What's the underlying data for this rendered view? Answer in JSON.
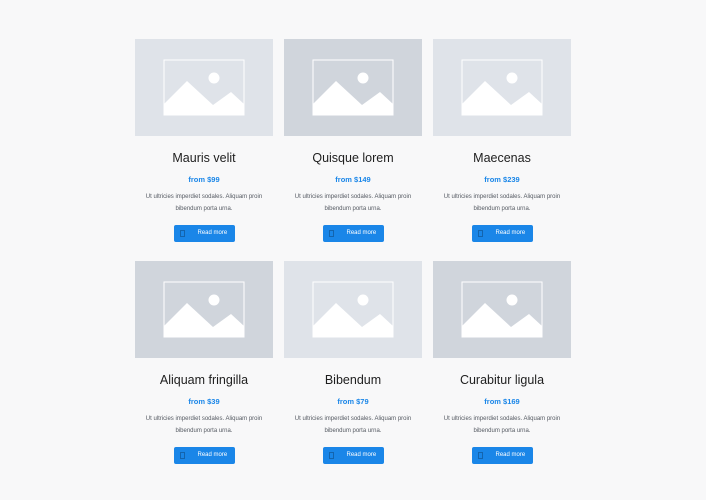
{
  "cards": [
    {
      "title": "Mauris velit",
      "price": "from $99",
      "description": "Ut ultricies imperdiet sodales. Aliquam proin bibendum porta urna.",
      "button_label": "Read more",
      "image_icon": "image-placeholder-icon",
      "tone": "light"
    },
    {
      "title": "Quisque lorem",
      "price": "from $149",
      "description": "Ut ultricies imperdiet sodales. Aliquam proin bibendum porta urna.",
      "button_label": "Read more",
      "image_icon": "image-placeholder-icon",
      "tone": "dark"
    },
    {
      "title": "Maecenas",
      "price": "from $239",
      "description": "Ut ultricies imperdiet sodales. Aliquam proin bibendum porta urna.",
      "button_label": "Read more",
      "image_icon": "image-placeholder-icon",
      "tone": "light"
    },
    {
      "title": "Aliquam fringilla",
      "price": "from $39",
      "description": "Ut ultricies imperdiet sodales. Aliquam proin bibendum porta urna.",
      "button_label": "Read more",
      "image_icon": "image-placeholder-icon",
      "tone": "dark"
    },
    {
      "title": "Bibendum",
      "price": "from $79",
      "description": "Ut ultricies imperdiet sodales. Aliquam proin bibendum porta urna.",
      "button_label": "Read more",
      "image_icon": "image-placeholder-icon",
      "tone": "light"
    },
    {
      "title": "Curabitur ligula",
      "price": "from $169",
      "description": "Ut ultricies imperdiet sodales. Aliquam proin bibendum porta urna.",
      "button_label": "Read more",
      "image_icon": "image-placeholder-icon",
      "tone": "dark"
    }
  ],
  "colors": {
    "accent": "#1a86e8",
    "page_background": "#f8f8f9",
    "thumb_light": "#dfe3e9",
    "thumb_dark": "#d0d5dc",
    "title_text": "#1e1e1e",
    "body_text": "#555a62"
  }
}
